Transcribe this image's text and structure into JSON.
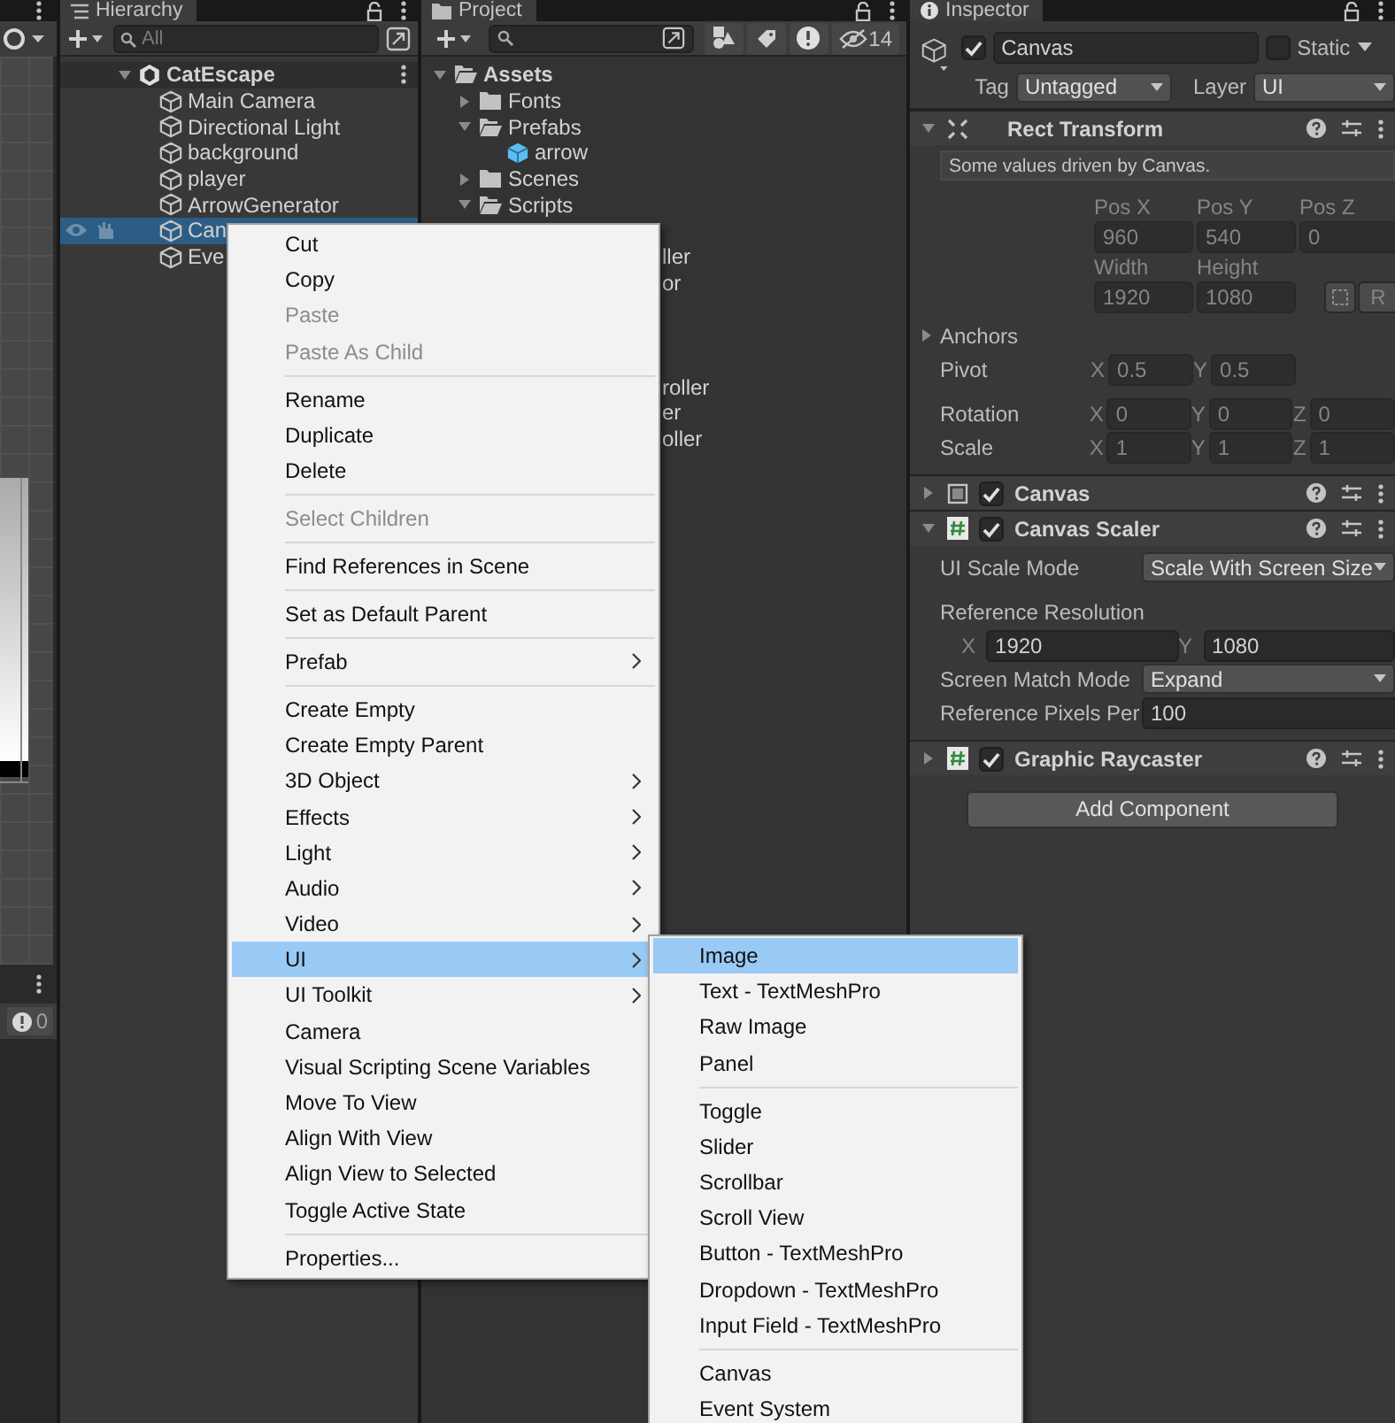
{
  "scene_view": {
    "warning_count": "0"
  },
  "hierarchy": {
    "title": "Hierarchy",
    "search": {
      "placeholder": "All"
    },
    "scene": {
      "name": "CatEscape",
      "expanded": true,
      "children": [
        {
          "name": "Main Camera",
          "selected": false
        },
        {
          "name": "Directional Light",
          "selected": false
        },
        {
          "name": "background",
          "selected": false
        },
        {
          "name": "player",
          "selected": false
        },
        {
          "name": "ArrowGenerator",
          "selected": false
        },
        {
          "name": "Can",
          "selected": true
        },
        {
          "name": "Eve",
          "selected": false
        }
      ]
    }
  },
  "project": {
    "title": "Project",
    "hidden_count": "14",
    "tree": [
      {
        "name": "Assets",
        "kind": "folder",
        "expanded": true,
        "children": [
          {
            "name": "Fonts",
            "kind": "folder",
            "expanded": false
          },
          {
            "name": "Prefabs",
            "kind": "folder",
            "expanded": true,
            "children": [
              {
                "name": "arrow",
                "kind": "prefab"
              }
            ]
          },
          {
            "name": "Scenes",
            "kind": "folder",
            "expanded": false
          },
          {
            "name": "Scripts",
            "kind": "folder",
            "expanded": true
          }
        ]
      }
    ],
    "covered_rows": [
      [
        "ller",
        "or"
      ],
      [
        "roller",
        "er",
        "oller"
      ]
    ]
  },
  "inspector": {
    "title": "Inspector",
    "object": {
      "active": true,
      "name": "Canvas",
      "static": false,
      "static_label": "Static",
      "tag_label": "Tag",
      "tag": "Untagged",
      "layer_label": "Layer",
      "layer": "UI"
    },
    "components": [
      {
        "kind": "rect_transform",
        "title": "Rect Transform",
        "expanded": true,
        "note": "Some values driven by Canvas.",
        "position": {
          "labels": [
            "Pos X",
            "Pos Y",
            "Pos Z"
          ],
          "values": [
            "960",
            "540",
            "0"
          ]
        },
        "size": {
          "labels": [
            "Width",
            "Height"
          ],
          "values": [
            "1920",
            "1080"
          ],
          "raw_button": "R"
        },
        "anchors": {
          "label": "Anchors",
          "expanded": false
        },
        "vectors": [
          {
            "label": "Pivot",
            "fields": [
              {
                "axis": "X",
                "value": "0.5"
              },
              {
                "axis": "Y",
                "value": "0.5"
              }
            ]
          },
          {
            "label": "Rotation",
            "fields": [
              {
                "axis": "X",
                "value": "0"
              },
              {
                "axis": "Y",
                "value": "0"
              },
              {
                "axis": "Z",
                "value": "0"
              }
            ]
          },
          {
            "label": "Scale",
            "fields": [
              {
                "axis": "X",
                "value": "1"
              },
              {
                "axis": "Y",
                "value": "1"
              },
              {
                "axis": "Z",
                "value": "1"
              }
            ]
          }
        ]
      },
      {
        "kind": "canvas",
        "title": "Canvas",
        "enabled": true,
        "expanded": false
      },
      {
        "kind": "script",
        "title": "Canvas Scaler",
        "enabled": true,
        "expanded": true,
        "properties": [
          {
            "kind": "dropdown",
            "label": "UI Scale Mode",
            "value": "Scale With Screen Size"
          },
          {
            "kind": "heading",
            "label": "Reference Resolution"
          },
          {
            "kind": "vector",
            "fields": [
              {
                "axis": "X",
                "value": "1920"
              },
              {
                "axis": "Y",
                "value": "1080"
              }
            ]
          },
          {
            "kind": "dropdown",
            "label": "Screen Match Mode",
            "value": "Expand"
          },
          {
            "kind": "number",
            "label": "Reference Pixels Per",
            "value": "100"
          }
        ]
      },
      {
        "kind": "script",
        "title": "Graphic Raycaster",
        "enabled": true,
        "expanded": false
      }
    ],
    "add_button": "Add Component"
  },
  "context_menu": {
    "items": [
      {
        "kind": "item",
        "label": "Cut",
        "disabled": false,
        "submenu": false,
        "selected": false
      },
      {
        "kind": "item",
        "label": "Copy",
        "disabled": false,
        "submenu": false,
        "selected": false
      },
      {
        "kind": "item",
        "label": "Paste",
        "disabled": true,
        "submenu": false,
        "selected": false
      },
      {
        "kind": "item",
        "label": "Paste As Child",
        "disabled": true,
        "submenu": false,
        "selected": false
      },
      {
        "kind": "separator"
      },
      {
        "kind": "item",
        "label": "Rename",
        "disabled": false,
        "submenu": false,
        "selected": false
      },
      {
        "kind": "item",
        "label": "Duplicate",
        "disabled": false,
        "submenu": false,
        "selected": false
      },
      {
        "kind": "item",
        "label": "Delete",
        "disabled": false,
        "submenu": false,
        "selected": false
      },
      {
        "kind": "separator"
      },
      {
        "kind": "item",
        "label": "Select Children",
        "disabled": true,
        "submenu": false,
        "selected": false
      },
      {
        "kind": "separator"
      },
      {
        "kind": "item",
        "label": "Find References in Scene",
        "disabled": false,
        "submenu": false,
        "selected": false
      },
      {
        "kind": "separator"
      },
      {
        "kind": "item",
        "label": "Set as Default Parent",
        "disabled": false,
        "submenu": false,
        "selected": false
      },
      {
        "kind": "separator"
      },
      {
        "kind": "item",
        "label": "Prefab",
        "disabled": false,
        "submenu": true,
        "selected": false
      },
      {
        "kind": "separator"
      },
      {
        "kind": "item",
        "label": "Create Empty",
        "disabled": false,
        "submenu": false,
        "selected": false
      },
      {
        "kind": "item",
        "label": "Create Empty Parent",
        "disabled": false,
        "submenu": false,
        "selected": false
      },
      {
        "kind": "item",
        "label": "3D Object",
        "disabled": false,
        "submenu": true,
        "selected": false
      },
      {
        "kind": "item",
        "label": "Effects",
        "disabled": false,
        "submenu": true,
        "selected": false
      },
      {
        "kind": "item",
        "label": "Light",
        "disabled": false,
        "submenu": true,
        "selected": false
      },
      {
        "kind": "item",
        "label": "Audio",
        "disabled": false,
        "submenu": true,
        "selected": false
      },
      {
        "kind": "item",
        "label": "Video",
        "disabled": false,
        "submenu": true,
        "selected": false
      },
      {
        "kind": "item",
        "label": "UI",
        "disabled": false,
        "submenu": true,
        "selected": true
      },
      {
        "kind": "item",
        "label": "UI Toolkit",
        "disabled": false,
        "submenu": true,
        "selected": false
      },
      {
        "kind": "item",
        "label": "Camera",
        "disabled": false,
        "submenu": false,
        "selected": false
      },
      {
        "kind": "item",
        "label": "Visual Scripting Scene Variables",
        "disabled": false,
        "submenu": false,
        "selected": false
      },
      {
        "kind": "item",
        "label": "Move To View",
        "disabled": false,
        "submenu": false,
        "selected": false
      },
      {
        "kind": "item",
        "label": "Align With View",
        "disabled": false,
        "submenu": false,
        "selected": false
      },
      {
        "kind": "item",
        "label": "Align View to Selected",
        "disabled": false,
        "submenu": false,
        "selected": false
      },
      {
        "kind": "item",
        "label": "Toggle Active State",
        "disabled": false,
        "submenu": false,
        "selected": false
      },
      {
        "kind": "separator"
      },
      {
        "kind": "item",
        "label": "Properties...",
        "disabled": false,
        "submenu": false,
        "selected": false
      }
    ]
  },
  "submenu": {
    "items": [
      {
        "kind": "item",
        "label": "Image",
        "disabled": false,
        "submenu": false,
        "selected": true
      },
      {
        "kind": "item",
        "label": "Text - TextMeshPro",
        "disabled": false,
        "submenu": false,
        "selected": false
      },
      {
        "kind": "item",
        "label": "Raw Image",
        "disabled": false,
        "submenu": false,
        "selected": false
      },
      {
        "kind": "item",
        "label": "Panel",
        "disabled": false,
        "submenu": false,
        "selected": false
      },
      {
        "kind": "separator"
      },
      {
        "kind": "item",
        "label": "Toggle",
        "disabled": false,
        "submenu": false,
        "selected": false
      },
      {
        "kind": "item",
        "label": "Slider",
        "disabled": false,
        "submenu": false,
        "selected": false
      },
      {
        "kind": "item",
        "label": "Scrollbar",
        "disabled": false,
        "submenu": false,
        "selected": false
      },
      {
        "kind": "item",
        "label": "Scroll View",
        "disabled": false,
        "submenu": false,
        "selected": false
      },
      {
        "kind": "item",
        "label": "Button - TextMeshPro",
        "disabled": false,
        "submenu": false,
        "selected": false
      },
      {
        "kind": "item",
        "label": "Dropdown - TextMeshPro",
        "disabled": false,
        "submenu": false,
        "selected": false
      },
      {
        "kind": "item",
        "label": "Input Field - TextMeshPro",
        "disabled": false,
        "submenu": false,
        "selected": false
      },
      {
        "kind": "separator"
      },
      {
        "kind": "item",
        "label": "Canvas",
        "disabled": false,
        "submenu": false,
        "selected": false
      },
      {
        "kind": "item",
        "label": "Event System",
        "disabled": false,
        "submenu": false,
        "selected": false
      }
    ]
  }
}
